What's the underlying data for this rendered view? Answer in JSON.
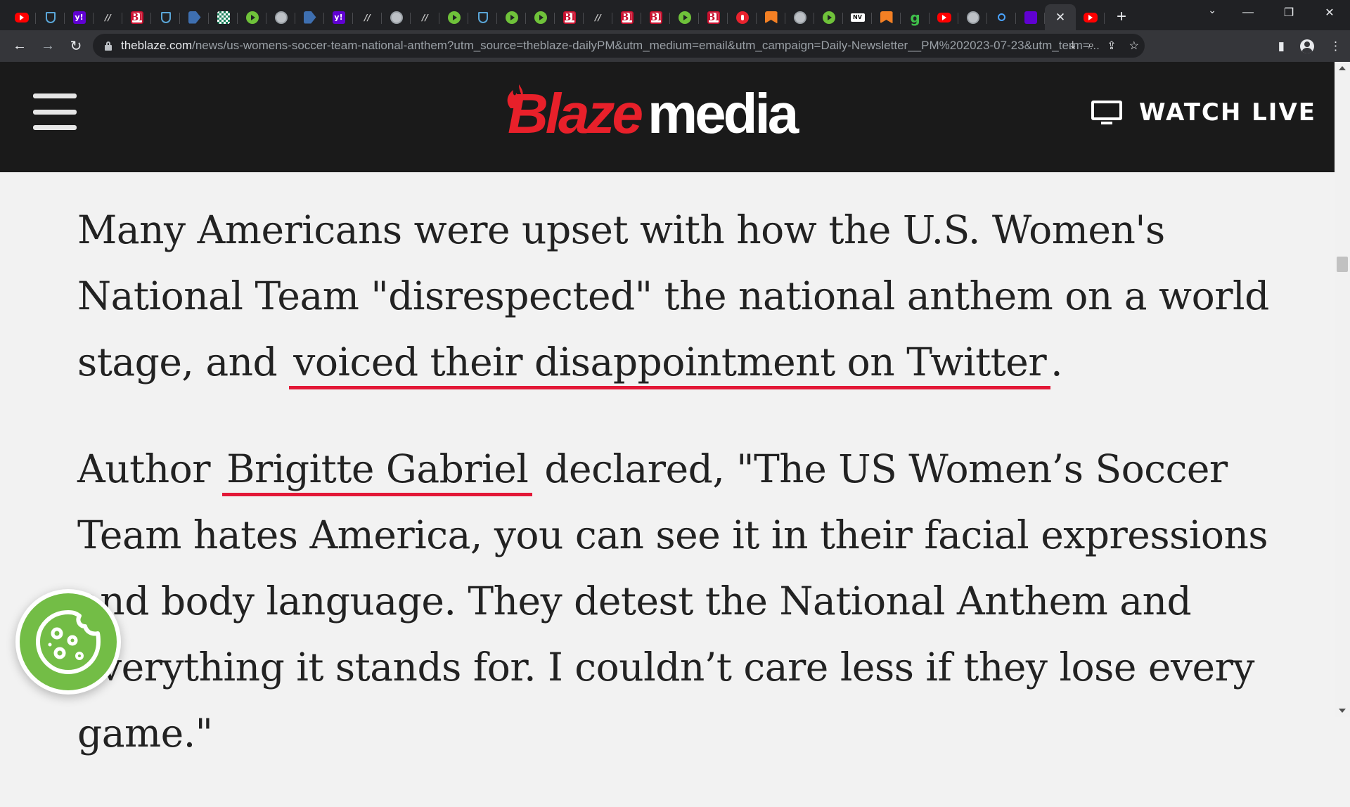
{
  "browser": {
    "tabs": [
      {
        "icon": "youtube-icon",
        "type": "youtube"
      },
      {
        "icon": "shield-icon",
        "type": "shield"
      },
      {
        "icon": "yahoo-icon",
        "type": "yahoo",
        "glyph": "y!"
      },
      {
        "icon": "slash-icon",
        "type": "slash",
        "glyph": "//"
      },
      {
        "icon": "bi-icon",
        "type": "bi",
        "glyph": "BI"
      },
      {
        "icon": "shield-icon",
        "type": "shield"
      },
      {
        "icon": "arrow-tag-icon",
        "type": "dblue"
      },
      {
        "icon": "chess-icon",
        "type": "chess"
      },
      {
        "icon": "play-icon",
        "type": "play"
      },
      {
        "icon": "globe-icon",
        "type": "globe"
      },
      {
        "icon": "arrow-tag-icon",
        "type": "dblue"
      },
      {
        "icon": "yahoo-icon",
        "type": "yahoo",
        "glyph": "y!"
      },
      {
        "icon": "slash-icon",
        "type": "slash",
        "glyph": "//"
      },
      {
        "icon": "globe-icon",
        "type": "globe"
      },
      {
        "icon": "slash-icon",
        "type": "slash",
        "glyph": "//"
      },
      {
        "icon": "play-icon",
        "type": "play"
      },
      {
        "icon": "shield-icon",
        "type": "shield"
      },
      {
        "icon": "play-icon",
        "type": "play"
      },
      {
        "icon": "play-icon",
        "type": "play"
      },
      {
        "icon": "bi-icon",
        "type": "bi",
        "glyph": "BI"
      },
      {
        "icon": "slash-icon",
        "type": "slash",
        "glyph": "//"
      },
      {
        "icon": "bi-icon",
        "type": "bi",
        "glyph": "BI"
      },
      {
        "icon": "bi-icon",
        "type": "bi",
        "glyph": "BI"
      },
      {
        "icon": "play-icon",
        "type": "play"
      },
      {
        "icon": "bi-icon",
        "type": "bi",
        "glyph": "BI"
      },
      {
        "icon": "mic-icon",
        "type": "mic"
      },
      {
        "icon": "bookmark-icon",
        "type": "bookmark"
      },
      {
        "icon": "globe-icon",
        "type": "globe"
      },
      {
        "icon": "play-icon",
        "type": "play"
      },
      {
        "icon": "bar-icon",
        "type": "bar",
        "glyph": "NV"
      },
      {
        "icon": "bookmark-icon",
        "type": "bookmark"
      },
      {
        "icon": "g-icon",
        "type": "g",
        "glyph": "g"
      },
      {
        "icon": "youtube-icon",
        "type": "youtube"
      },
      {
        "icon": "globe-icon",
        "type": "globe"
      },
      {
        "icon": "search-icon",
        "type": "search"
      },
      {
        "icon": "mail-icon",
        "type": "mail"
      }
    ],
    "active_tab_close": "✕",
    "after_active": {
      "icon": "youtube-icon",
      "type": "youtube"
    },
    "new_tab": "+",
    "tab_search": "⌄",
    "window_controls": {
      "minimize": "—",
      "restore": "❐",
      "close": "✕"
    },
    "nav": {
      "back": "←",
      "forward": "→",
      "reload": "↻"
    },
    "url_host": "theblaze.com",
    "url_path": "/news/us-womens-soccer-team-national-anthem?utm_source=theblaze-dailyPM&utm_medium=email&utm_campaign=Daily-Newsletter__PM%202023-07-23&utm_term=...",
    "omnibox_icons": {
      "install": "⤓",
      "zoom": "⌕",
      "share": "⇪",
      "bookmark": "☆"
    },
    "toolbar_icons": {
      "side_panel": "▮",
      "menu": "⋮"
    }
  },
  "site": {
    "logo_blaze": "Blaze",
    "logo_media": "media",
    "watch_live": "WATCH LIVE",
    "brand_color": "#e8202a"
  },
  "article": {
    "p1_before": "Many Americans were upset with how the U.S. Women's National Team \"disrespected\" the national anthem on a world stage, and",
    "p1_link": "voiced their disappointment on Twitter",
    "p1_after": ".",
    "p2_before": "Author",
    "p2_link": "Brigitte Gabriel",
    "p2_after": "declared, \"The US Women’s Soccer Team hates America, you can see it in their facial expressions and body language. They detest the National Anthem and everything it stands for. I couldn’t care less if they lose every game.\""
  }
}
